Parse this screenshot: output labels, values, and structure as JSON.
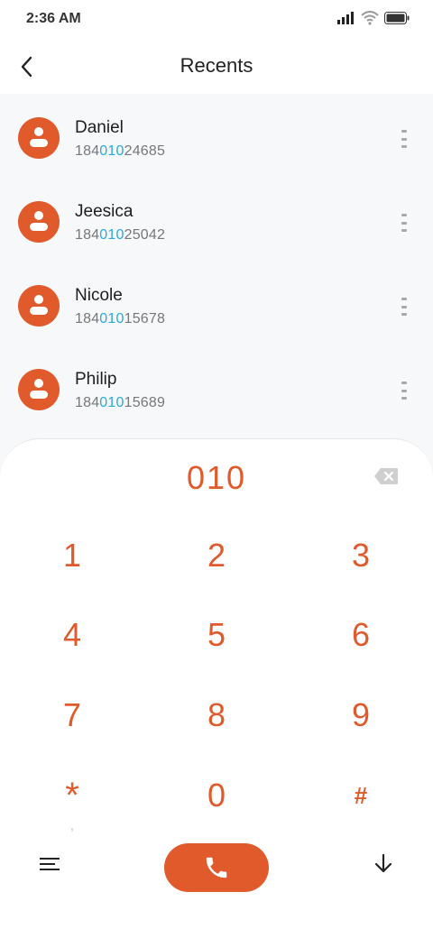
{
  "status_bar": {
    "time": "2:36 AM",
    "icons": [
      "signal-icon",
      "wifi-icon",
      "battery-icon"
    ]
  },
  "header": {
    "title": "Recents",
    "back_icon": "chevron-left-icon"
  },
  "recents": [
    {
      "name": "Daniel",
      "number_prefix": "184",
      "number_match": "010",
      "number_suffix": "24685"
    },
    {
      "name": "Jeesica",
      "number_prefix": "184",
      "number_match": "010",
      "number_suffix": "25042"
    },
    {
      "name": "Nicole",
      "number_prefix": "184",
      "number_match": "010",
      "number_suffix": "15678"
    },
    {
      "name": "Philip",
      "number_prefix": "184",
      "number_match": "010",
      "number_suffix": "15689"
    }
  ],
  "dialpad": {
    "input": "010",
    "keys": [
      "1",
      "2",
      "3",
      "4",
      "5",
      "6",
      "7",
      "8",
      "9",
      "*",
      "0",
      "#"
    ],
    "star_sub": ",",
    "icons": [
      "backspace-icon",
      "menu-icon",
      "phone-icon",
      "arrow-down-icon"
    ]
  },
  "colors": {
    "accent": "#e05a2b",
    "match_highlight": "#2aa9dc",
    "list_background": "#f7f8fa"
  }
}
